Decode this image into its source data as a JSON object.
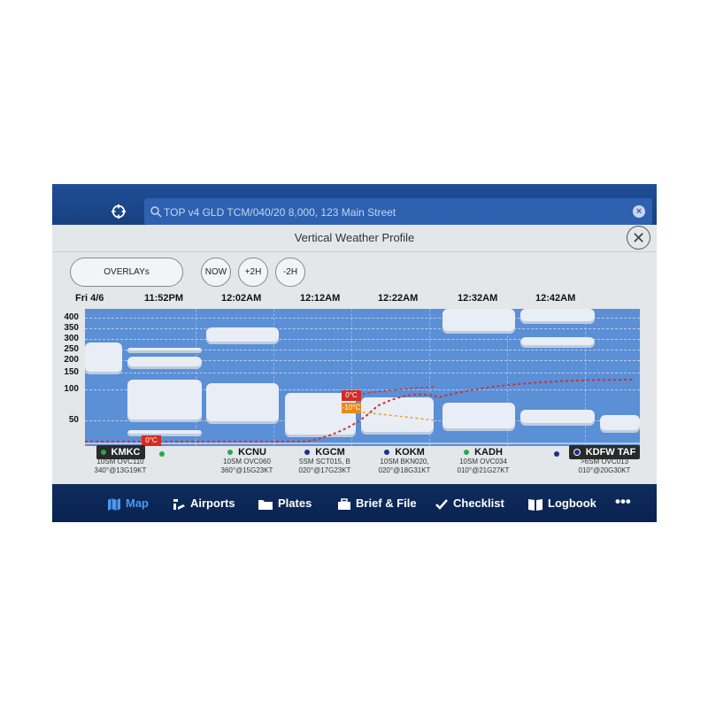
{
  "search": {
    "query": "TOP v4 GLD TCM/040/20 8,000, 123 Main Street"
  },
  "panel": {
    "title": "Vertical Weather Profile",
    "close_label": "✕"
  },
  "controls": {
    "overlays": "OVERLAYs",
    "now": "NOW",
    "plus2h": "+2H",
    "minus2h": "-2H"
  },
  "times": [
    "Fri 4/6",
    "11:52PM",
    "12:02AM",
    "12:12AM",
    "12:22AM",
    "12:32AM",
    "12:42AM"
  ],
  "altitude_labels": [
    "400",
    "350",
    "300",
    "250",
    "200",
    "150",
    "100",
    "50"
  ],
  "temperature_markers": [
    "0°C",
    "0°C",
    "-10°C"
  ],
  "stations": [
    {
      "id": "KMKC",
      "line1": "10SM OVC110",
      "line2": "340°@13G19KT",
      "dot_color": "#2aa84a"
    },
    {
      "id": "KCNU",
      "line1": "10SM OVC060",
      "line2": "360°@15G23KT",
      "dot_color": "#2aa84a"
    },
    {
      "id": "KGCM",
      "line1": "5SM SCT015, B",
      "line2": "020°@17G23KT",
      "dot_color": "#1c2f8a"
    },
    {
      "id": "KOKM",
      "line1": "10SM BKN020,",
      "line2": "020°@18G31KT",
      "dot_color": "#1c2f8a"
    },
    {
      "id": "KADH",
      "line1": "10SM OVC034",
      "line2": "010°@21G27KT",
      "dot_color": "#2aa84a"
    },
    {
      "id": "KDFW TAF",
      "line1": ">6SM OVC013",
      "line2": "010°@20G30KT",
      "dot_color": "#1c2f8a"
    }
  ],
  "nav": {
    "map": "Map",
    "airports": "Airports",
    "plates": "Plates",
    "brief": "Brief & File",
    "checklist": "Checklist",
    "logbook": "Logbook",
    "more": "•••"
  },
  "colors": {
    "accent": "#4a9af0",
    "chart_bg": "#5b8fd6",
    "freezing_line": "#d0312d"
  }
}
